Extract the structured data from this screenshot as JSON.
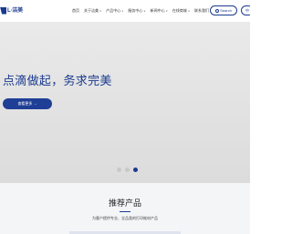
{
  "header": {
    "logo_text": "L·洁美",
    "nav": [
      {
        "label": "首页",
        "caret": false
      },
      {
        "label": "关于洁美",
        "caret": true
      },
      {
        "label": "产品中心",
        "caret": true
      },
      {
        "label": "服务中心",
        "caret": true
      },
      {
        "label": "新闻中心",
        "caret": true
      },
      {
        "label": "在线商城",
        "caret": true
      },
      {
        "label": "联系我们",
        "caret": true
      }
    ],
    "caret_glyph": "∨",
    "search_label": "Search",
    "lang_label": "中"
  },
  "hero": {
    "title": "点滴做起，务求完美",
    "cta_label": "查看更多 →",
    "dots": [
      false,
      false,
      true
    ]
  },
  "section": {
    "title": "推荐产品",
    "subtitle": "为客户提供专业、全品类的打印耗材产品"
  },
  "colors": {
    "brand": "#1a3a8f",
    "hero_bg": "#e1e1e1",
    "section_bg": "#f4f5f7"
  }
}
